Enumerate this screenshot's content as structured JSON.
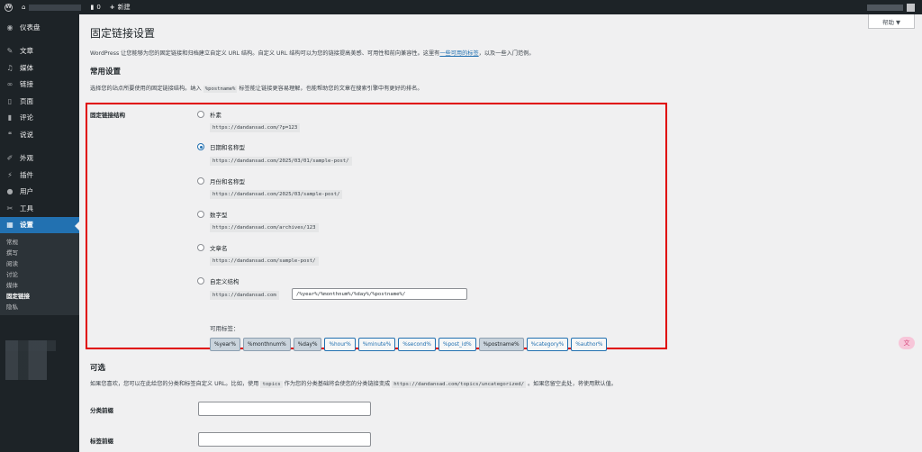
{
  "adminbar": {
    "comments_count": "0",
    "new_label": "新建"
  },
  "sidebar": {
    "items": [
      {
        "label": "仪表盘",
        "icon": "dashboard-icon"
      },
      {
        "label": "文章",
        "icon": "pin-icon"
      },
      {
        "label": "媒体",
        "icon": "media-icon"
      },
      {
        "label": "链接",
        "icon": "link-icon"
      },
      {
        "label": "页面",
        "icon": "page-icon"
      },
      {
        "label": "评论",
        "icon": "comment-icon"
      },
      {
        "label": "说说",
        "icon": "talk-icon"
      },
      {
        "label": "外观",
        "icon": "brush-icon"
      },
      {
        "label": "插件",
        "icon": "plugin-icon"
      },
      {
        "label": "用户",
        "icon": "user-icon"
      },
      {
        "label": "工具",
        "icon": "wrench-icon"
      },
      {
        "label": "设置",
        "icon": "settings-icon"
      }
    ],
    "submenu": [
      "常规",
      "撰写",
      "阅读",
      "讨论",
      "媒体",
      "固定链接",
      "隐私"
    ]
  },
  "help_tab": "帮助 ▼",
  "page_title": "固定链接设置",
  "intro": {
    "before": "WordPress 让您能够为您的固定链接和归档建立自定义 URL 结构。自定义 URL 结构可以为您的链接提高美感、可用性和前向兼容性。这里有",
    "link": "一些可用的标签",
    "after": "，以及一些入门范例。"
  },
  "common": {
    "heading": "常用设置",
    "desc_before": "选择您的站点所要使用的固定链接结构。纳入",
    "desc_code": "%postname%",
    "desc_after": "标签能让链接更容易理解，也能帮助您的文章在搜索引擎中有更好的排名。",
    "row_label": "固定链接结构",
    "options": [
      {
        "label": "朴素",
        "example": "https://dandansad.com/?p=123",
        "checked": false
      },
      {
        "label": "日期和名称型",
        "example": "https://dandansad.com/2025/03/01/sample-post/",
        "checked": true
      },
      {
        "label": "月份和名称型",
        "example": "https://dandansad.com/2025/03/sample-post/",
        "checked": false
      },
      {
        "label": "数字型",
        "example": "https://dandansad.com/archives/123",
        "checked": false
      },
      {
        "label": "文章名",
        "example": "https://dandansad.com/sample-post/",
        "checked": false
      },
      {
        "label": "自定义结构",
        "example": "https://dandansad.com",
        "checked": false
      }
    ],
    "custom_value": "/%year%/%monthnum%/%day%/%postname%/",
    "available_label": "可用标签：",
    "tags": [
      {
        "label": "%year%",
        "active": true
      },
      {
        "label": "%monthnum%",
        "active": true
      },
      {
        "label": "%day%",
        "active": true
      },
      {
        "label": "%hour%",
        "active": false
      },
      {
        "label": "%minute%",
        "active": false
      },
      {
        "label": "%second%",
        "active": false
      },
      {
        "label": "%post_id%",
        "active": false
      },
      {
        "label": "%postname%",
        "active": true
      },
      {
        "label": "%category%",
        "active": false
      },
      {
        "label": "%author%",
        "active": false
      }
    ]
  },
  "optional": {
    "heading": "可选",
    "desc_1": "如果您喜欢，您可以在此给您的分类和标签自定义 URL。比如，使用",
    "code_1": "topics",
    "desc_2": "作为您的分类基础将会使您的分类链接变成",
    "code_2": "https://dandansad.com/topics/uncategorized/",
    "desc_3": "。如果您留空此处，将使用默认值。",
    "category_label": "分类前缀",
    "tag_label": "标签前缀"
  },
  "floating_icon": "translate-icon",
  "highlight_color": "#e00000",
  "accent": "#2271b1"
}
